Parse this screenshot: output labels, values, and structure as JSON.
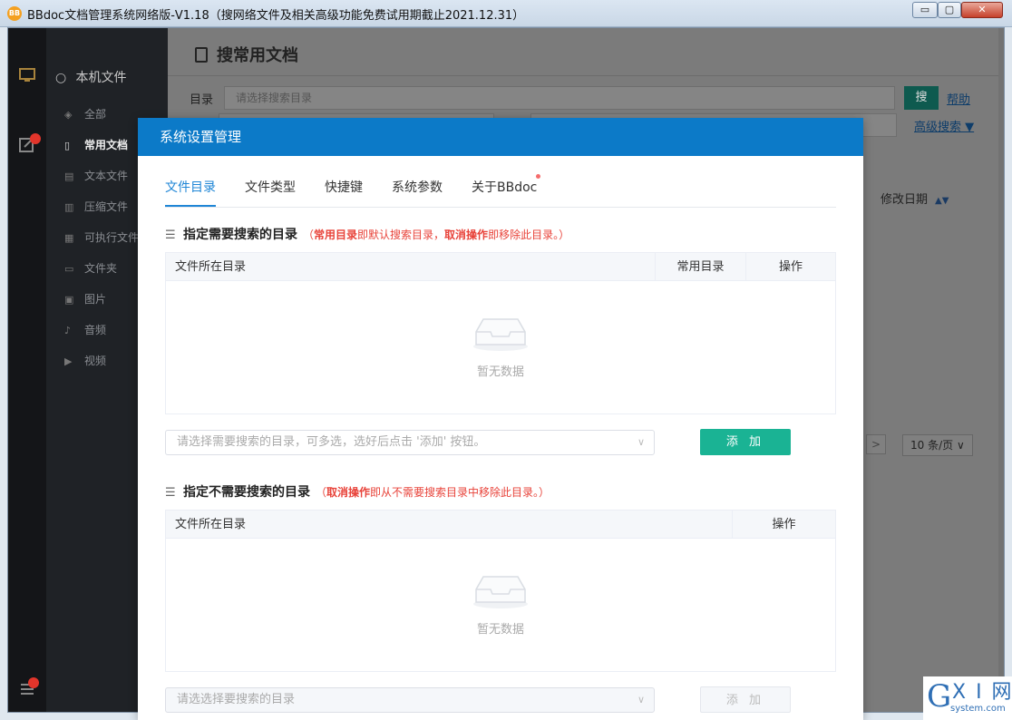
{
  "window": {
    "app_icon_text": "BB",
    "title": "BBdoc文档管理系统网络版-V1.18（搜网络文件及相关高级功能免费试用期截止2021.12.31）",
    "min_label": "▭",
    "max_label": "▢",
    "close_label": "✕"
  },
  "sidebar": {
    "header": "本机文件",
    "items": [
      {
        "label": "全部",
        "icon": "layers-icon",
        "glyph": "◈"
      },
      {
        "label": "常用文档",
        "icon": "document-icon",
        "glyph": "▯"
      },
      {
        "label": "文本文件",
        "icon": "text-file-icon",
        "glyph": "▤"
      },
      {
        "label": "压缩文件",
        "icon": "archive-icon",
        "glyph": "▥"
      },
      {
        "label": "可执行文件",
        "icon": "executable-icon",
        "glyph": "▦"
      },
      {
        "label": "文件夹",
        "icon": "folder-icon",
        "glyph": "▭"
      },
      {
        "label": "图片",
        "icon": "image-icon",
        "glyph": "▣"
      },
      {
        "label": "音频",
        "icon": "audio-icon",
        "glyph": "♪"
      },
      {
        "label": "视频",
        "icon": "video-icon",
        "glyph": "▶"
      }
    ]
  },
  "main": {
    "page_title": "搜常用文档",
    "dir_label": "目录",
    "dir_placeholder": "请选择搜索目录",
    "search_button": "搜",
    "help_link": "帮助",
    "advanced_link": "高级搜索 ▼",
    "column_modified": "修改日期",
    "pagination_next": ">",
    "page_size": "10 条/页"
  },
  "modal": {
    "title": "系统设置管理",
    "tabs": [
      "文件目录",
      "文件类型",
      "快捷键",
      "系统参数",
      "关于BBdoc"
    ],
    "section1": {
      "title": "指定需要搜索的目录",
      "note_prefix": "（",
      "note_bold": "常用目录",
      "note_mid": "即默认搜索目录，",
      "note_bold2": "取消操作",
      "note_suffix": "即移除此目录。）",
      "col_dir": "文件所在目录",
      "col_common": "常用目录",
      "col_action": "操作",
      "empty": "暂无数据",
      "select_placeholder": "请选择需要搜索的目录，可多选，选好后点击 '添加' 按钮。",
      "add_button": "添 加"
    },
    "section2": {
      "title": "指定不需要搜索的目录",
      "note_prefix": "（",
      "note_bold": "取消操作",
      "note_suffix": "即从不需要搜索目录中移除此目录。）",
      "col_dir": "文件所在目录",
      "col_action": "操作",
      "empty": "暂无数据",
      "select_placeholder": "请选选择要搜索的目录",
      "add_button": "添 加"
    }
  },
  "watermark": {
    "g": "G",
    "xi": "X I 网",
    "domain": "system.com"
  },
  "colors": {
    "accent": "#0c7ac8",
    "add_button": "#1ab394",
    "note": "#e8433a"
  }
}
